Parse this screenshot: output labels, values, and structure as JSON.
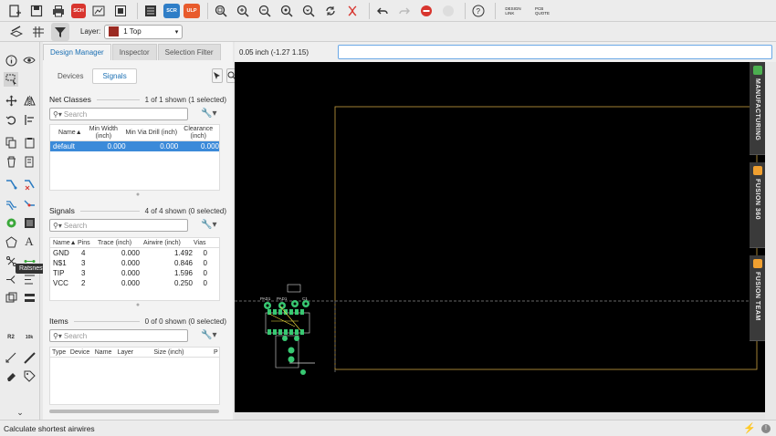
{
  "toolbar2": {
    "layer_label": "Layer:",
    "layer_value": "1 Top"
  },
  "tooltip": {
    "text": "Ratsnest"
  },
  "tabs": [
    {
      "label": "Design Manager"
    },
    {
      "label": "Inspector"
    },
    {
      "label": "Selection Filter"
    }
  ],
  "subtabs": [
    {
      "label": "Devices"
    },
    {
      "label": "Signals"
    }
  ],
  "search_placeholder": "Search",
  "net_classes": {
    "title": "Net Classes",
    "count": "1 of 1 shown (1 selected)",
    "headers": [
      "Name▲",
      "Min Width (inch)",
      "Min Via Drill (inch)",
      "Clearance (inch)"
    ],
    "rows": [
      [
        "default",
        "0.000",
        "0.000",
        "0.000"
      ]
    ]
  },
  "signals": {
    "title": "Signals",
    "count": "4 of 4 shown (0 selected)",
    "headers": [
      "Name▲",
      "Pins",
      "Trace (inch)",
      "Airwire (inch)",
      "Vias"
    ],
    "rows": [
      [
        "GND",
        "4",
        "0.000",
        "1.492",
        "0"
      ],
      [
        "N$1",
        "3",
        "0.000",
        "0.846",
        "0"
      ],
      [
        "TIP",
        "3",
        "0.000",
        "1.596",
        "0"
      ],
      [
        "VCC",
        "2",
        "0.000",
        "0.250",
        "0"
      ]
    ]
  },
  "items": {
    "title": "Items",
    "count": "0 of 0 shown (0 selected)",
    "headers": [
      "Type",
      "Device",
      "Name",
      "Layer",
      "Size (inch)",
      "P"
    ]
  },
  "coord": {
    "text": "0.05 inch (-1.27 1.15)"
  },
  "right_tabs": [
    {
      "label": "MANUFACTURING",
      "color": "#4caf50"
    },
    {
      "label": "FUSION 360",
      "color": "#f0a030"
    },
    {
      "label": "FUSION TEAM",
      "color": "#f0a030"
    }
  ],
  "pcb_labels": {
    "pad1": "PAD1",
    "pad2": "PAD1",
    "c1": "C1"
  },
  "toolbar_text": {
    "design_link": "DESIGN\nLINK",
    "pcb_quote": "PCB\nQUOTE",
    "sch": "SCH",
    "scr": "SCR",
    "ulp": "ULP"
  },
  "status": {
    "text": "Calculate shortest airwires"
  }
}
